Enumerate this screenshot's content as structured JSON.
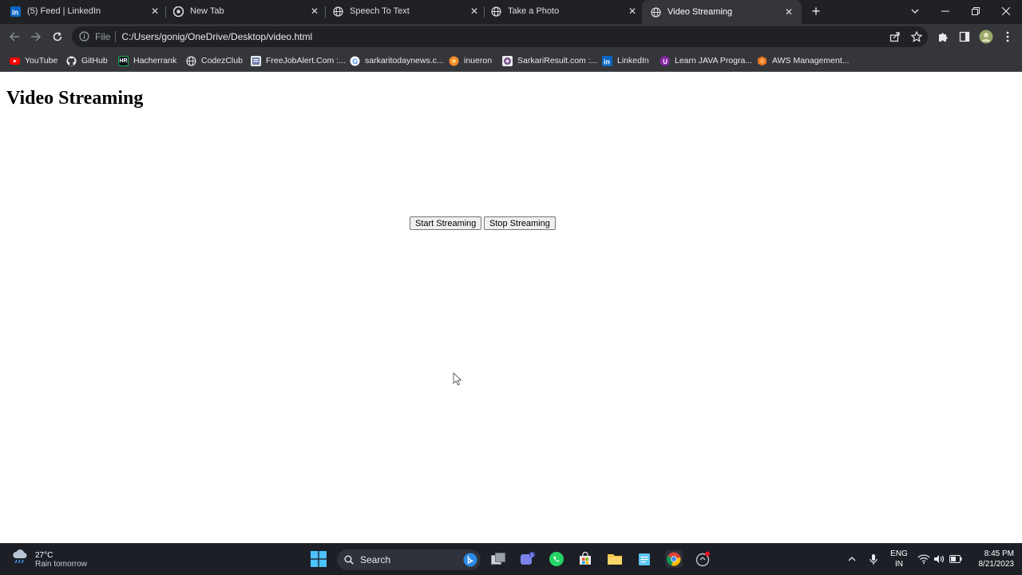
{
  "tabs": [
    {
      "title": "(5) Feed | LinkedIn",
      "icon": "linkedin-icon"
    },
    {
      "title": "New Tab",
      "icon": "chrome-icon"
    },
    {
      "title": "Speech To Text",
      "icon": "globe-icon"
    },
    {
      "title": "Take a Photo",
      "icon": "globe-icon"
    },
    {
      "title": "Video Streaming",
      "icon": "globe-icon",
      "active": true
    }
  ],
  "toolbar": {
    "scheme": "File",
    "url": "C:/Users/gonig/OneDrive/Desktop/video.html"
  },
  "bookmarks": [
    {
      "label": "YouTube",
      "icon": "youtube-icon"
    },
    {
      "label": "GitHub",
      "icon": "github-icon"
    },
    {
      "label": "Hacherrank",
      "icon": "hackerrank-icon"
    },
    {
      "label": "CodezClub",
      "icon": "globe-icon"
    },
    {
      "label": "FreeJobAlert.Com :...",
      "icon": "freejobalert-icon"
    },
    {
      "label": "sarkaritodaynews.c...",
      "icon": "google-icon"
    },
    {
      "label": "inueron",
      "icon": "ineuron-icon"
    },
    {
      "label": "SarkariResult.com :...",
      "icon": "sarkariresult-icon"
    },
    {
      "label": "LinkedIn",
      "icon": "linkedin-icon"
    },
    {
      "label": "Learn JAVA Progra...",
      "icon": "java-icon"
    },
    {
      "label": "AWS Management...",
      "icon": "aws-icon"
    }
  ],
  "page": {
    "heading": "Video Streaming",
    "start_label": "Start Streaming",
    "stop_label": "Stop Streaming"
  },
  "taskbar": {
    "temperature": "27°C",
    "forecast": "Rain tomorrow",
    "search_label": "Search",
    "language_top": "ENG",
    "language_bottom": "IN",
    "time": "8:45 PM",
    "date": "8/21/2023"
  },
  "colors": {
    "tabstrip": "#202124",
    "toolbar": "#35363a",
    "taskbar": "#1c1f26",
    "linkedin": "#0a66c2",
    "youtube": "#ff0000"
  }
}
